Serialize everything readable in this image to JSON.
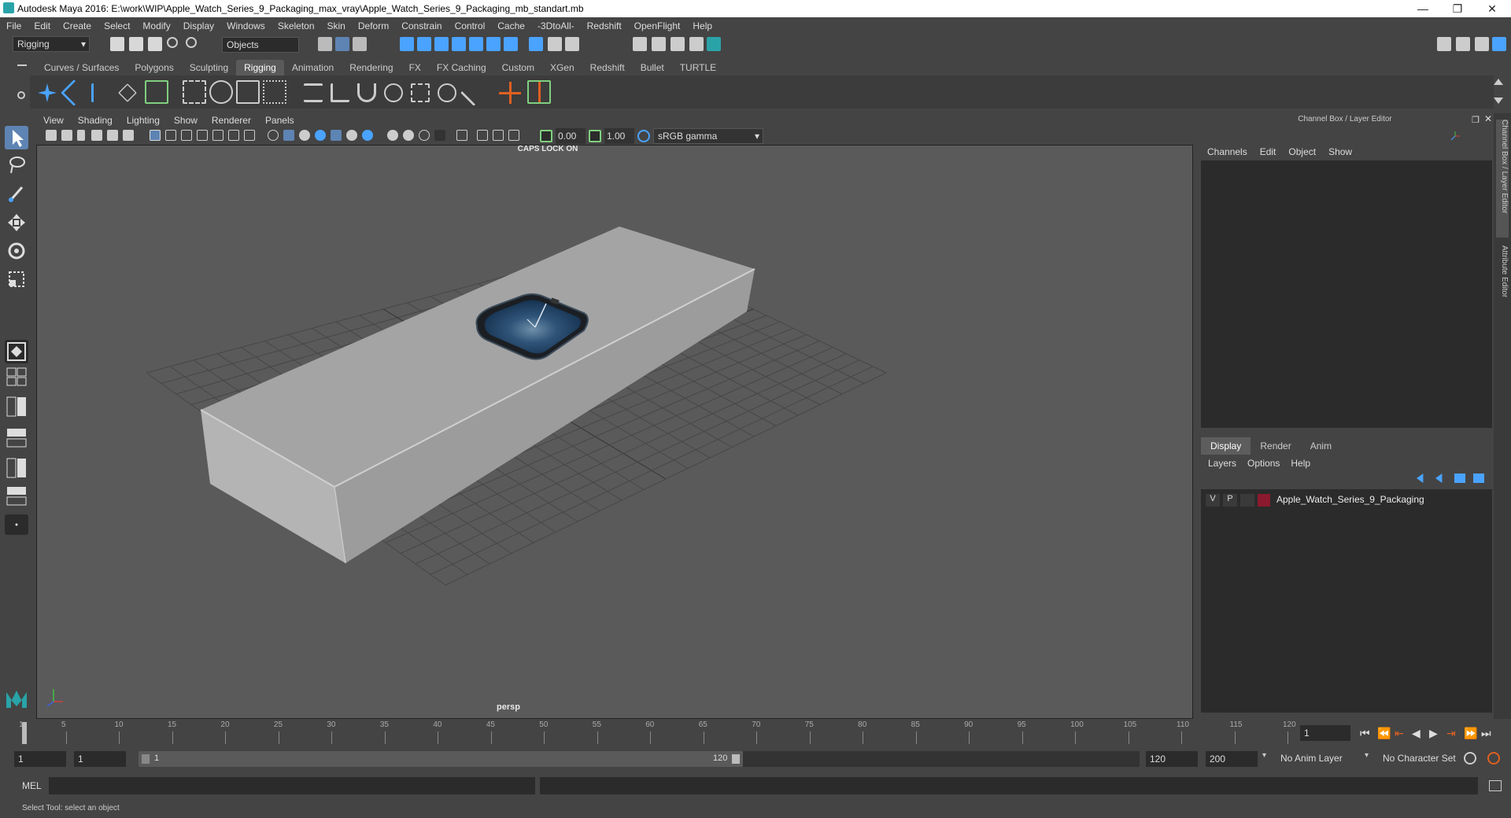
{
  "window": {
    "title": "Autodesk Maya 2016: E:\\work\\WIP\\Apple_Watch_Series_9_Packaging_max_vray\\Apple_Watch_Series_9_Packaging_mb_standart.mb",
    "minimize": "—",
    "restore": "❐",
    "close": "✕"
  },
  "menubar": [
    "File",
    "Edit",
    "Create",
    "Select",
    "Modify",
    "Display",
    "Windows",
    "Skeleton",
    "Skin",
    "Deform",
    "Constrain",
    "Control",
    "Cache",
    "-3DtoAll-",
    "Redshift",
    "OpenFlight",
    "Help"
  ],
  "statusline": {
    "menuset": "Rigging",
    "selmode": "Objects"
  },
  "shelf": {
    "tabs": [
      "Curves / Surfaces",
      "Polygons",
      "Sculpting",
      "Rigging",
      "Animation",
      "Rendering",
      "FX",
      "FX Caching",
      "Custom",
      "XGen",
      "Redshift",
      "Bullet",
      "TURTLE"
    ],
    "active_tab": "Rigging"
  },
  "viewport": {
    "menu": [
      "View",
      "Shading",
      "Lighting",
      "Show",
      "Renderer",
      "Panels"
    ],
    "exposure": "0.00",
    "gamma": "1.00",
    "colorspace": "sRGB gamma",
    "caps_lock": "CAPS LOCK ON",
    "camera": "persp"
  },
  "channelbox": {
    "title": "Channel Box / Layer Editor",
    "menu": [
      "Channels",
      "Edit",
      "Object",
      "Show"
    ],
    "vertical_tabs": [
      "Channel Box / Layer Editor",
      "Attribute Editor"
    ]
  },
  "layereditor": {
    "tabs": [
      "Display",
      "Render",
      "Anim"
    ],
    "active_tab": "Display",
    "menu": [
      "Layers",
      "Options",
      "Help"
    ],
    "layers": [
      {
        "v": "V",
        "p": "P",
        "name": "Apple_Watch_Series_9_Packaging",
        "color": "#8b1a2e"
      }
    ]
  },
  "timeslider": {
    "ticks": [
      "1",
      "5",
      "10",
      "15",
      "20",
      "25",
      "30",
      "35",
      "40",
      "45",
      "50",
      "55",
      "60",
      "65",
      "70",
      "75",
      "80",
      "85",
      "90",
      "95",
      "100",
      "105",
      "110",
      "115",
      "120"
    ],
    "current_frame": "1"
  },
  "range": {
    "start": "1",
    "playback_start": "1",
    "slider_start": "1",
    "slider_end": "120",
    "playback_end": "120",
    "end": "200",
    "anim_layer": "No Anim Layer",
    "character_set": "No Character Set"
  },
  "cmdline": {
    "label": "MEL"
  },
  "helpline": {
    "text": "Select Tool: select an object"
  },
  "colors": {
    "accent_teal": "#2aa3a8",
    "icon_blue": "#4aa3ff",
    "active_tool": "#5e84b3"
  }
}
